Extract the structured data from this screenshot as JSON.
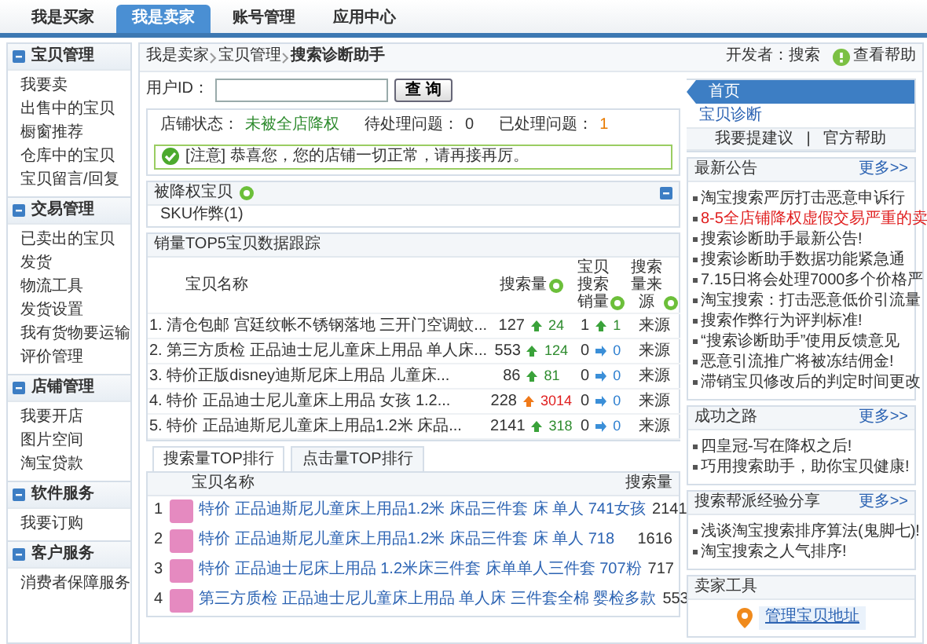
{
  "top_tabs": [
    {
      "label": "我是买家",
      "selected": false
    },
    {
      "label": "我是卖家",
      "selected": true
    },
    {
      "label": "账号管理",
      "selected": false
    },
    {
      "label": "应用中心",
      "selected": false
    }
  ],
  "sidebar": {
    "groups": [
      {
        "title": "宝贝管理",
        "items": [
          "我要卖",
          "出售中的宝贝",
          "橱窗推荐",
          "仓库中的宝贝",
          "宝贝留言/回复"
        ]
      },
      {
        "title": "交易管理",
        "items": [
          "已卖出的宝贝",
          "发货",
          "物流工具",
          "发货设置",
          "我有货物要运输",
          "评价管理"
        ]
      },
      {
        "title": "店铺管理",
        "items": [
          "我要开店",
          "图片空间",
          "淘宝贷款"
        ]
      },
      {
        "title": "软件服务",
        "items": [
          "我要订购"
        ]
      },
      {
        "title": "客户服务",
        "items": [
          "消费者保障服务"
        ]
      }
    ]
  },
  "breadcrumb": [
    "我是卖家",
    "宝贝管理",
    "搜索诊断助手"
  ],
  "developer": "开发者：搜索",
  "help_link": "查看帮助",
  "user_id": {
    "label": "用户ID：",
    "button": "查 询"
  },
  "status": {
    "shop_label": "店铺状态：",
    "shop_value": "未被全店降权",
    "pending_label": "待处理问题：",
    "pending_value": "0",
    "handled_label": "已处理问题：",
    "handled_value": "1"
  },
  "notice": "[注意] 恭喜您，您的店铺一切正常，请再接再厉。",
  "demoted": {
    "title": "被降权宝贝",
    "items": [
      "SKU作弊(1)"
    ]
  },
  "top5": {
    "title": "销量TOP5宝贝数据跟踪",
    "columns": [
      "宝贝名称",
      "搜索量",
      "宝贝搜索销量",
      "搜索量来源"
    ],
    "rows": [
      {
        "name": "1. 清仓包邮 宫廷纹帐不锈钢落地 三开门空调蚊...",
        "search": {
          "value": "127",
          "change": "24",
          "kind": "up"
        },
        "sales": {
          "value": "1",
          "change": "1",
          "kind": "up"
        },
        "source": "来源"
      },
      {
        "name": "2. 第三方质检 正品迪士尼儿童床上用品 单人床...",
        "search": {
          "value": "553",
          "change": "124",
          "kind": "up"
        },
        "sales": {
          "value": "0",
          "change": "0",
          "kind": "flat"
        },
        "source": "来源"
      },
      {
        "name": "3. 特价正版disney迪斯尼床上用品 儿童床...",
        "search": {
          "value": "86",
          "change": "81",
          "kind": "up"
        },
        "sales": {
          "value": "0",
          "change": "0",
          "kind": "flat"
        },
        "source": "来源"
      },
      {
        "name": "4. 特价 正品迪士尼儿童床上用品 女孩 1.2...",
        "search": {
          "value": "228",
          "change": "3014",
          "kind": "surge"
        },
        "sales": {
          "value": "0",
          "change": "0",
          "kind": "flat"
        },
        "source": "来源"
      },
      {
        "name": "5. 特价 正品迪斯尼儿童床上用品1.2米 床品...",
        "search": {
          "value": "2141",
          "change": "318",
          "kind": "up"
        },
        "sales": {
          "value": "0",
          "change": "0",
          "kind": "flat"
        },
        "source": "来源"
      }
    ]
  },
  "rank_tabs": [
    {
      "label": "搜索量TOP排行",
      "selected": true
    },
    {
      "label": "点击量TOP排行",
      "selected": false
    }
  ],
  "ranking": {
    "columns": [
      "宝贝名称",
      "搜索量"
    ],
    "rows": [
      {
        "rank": "1",
        "name": "特价 正品迪斯尼儿童床上用品1.2米 床品三件套 床 单人 741女孩",
        "value": "2141"
      },
      {
        "rank": "2",
        "name": "特价 正品迪斯尼儿童床上用品1.2米 床品三件套 床 单人 718",
        "value": "1616"
      },
      {
        "rank": "3",
        "name": "特价 正品迪士尼床上用品 1.2米床三件套 床单单人三件套 707粉",
        "value": "717"
      },
      {
        "rank": "4",
        "name": "第三方质检 正品迪士尼儿童床上用品 单人床 三件套全棉 婴检多款",
        "value": "553"
      }
    ]
  },
  "side_nav": [
    {
      "label": "首页",
      "selected": true
    },
    {
      "label": "宝贝诊断",
      "selected": false
    }
  ],
  "side_links": [
    "我要提建议",
    "|",
    "官方帮助"
  ],
  "panels": [
    {
      "title": "最新公告",
      "more": "更多>>",
      "items": [
        {
          "text": "淘宝搜索严厉打击恶意申诉行",
          "highlight": false
        },
        {
          "text": "8-5全店铺降权虚假交易严重的卖",
          "highlight": true
        },
        {
          "text": "搜索诊断助手最新公告!",
          "highlight": false
        },
        {
          "text": "搜索诊断助手数据功能紧急通",
          "highlight": false
        },
        {
          "text": "7.15日将会处理7000多个价格严",
          "highlight": false
        },
        {
          "text": "淘宝搜索：打击恶意低价引流量",
          "highlight": false
        },
        {
          "text": "搜索作弊行为评判标准!",
          "highlight": false
        },
        {
          "text": "“搜索诊断助手”使用反馈意见",
          "highlight": false
        },
        {
          "text": "恶意引流推广将被冻结佣金!",
          "highlight": false
        },
        {
          "text": "滞销宝贝修改后的判定时间更改",
          "highlight": false
        }
      ]
    },
    {
      "title": "成功之路",
      "more": "更多>>",
      "items": [
        {
          "text": "四皇冠-写在降权之后!",
          "highlight": false
        },
        {
          "text": "巧用搜索助手，助你宝贝健康!",
          "highlight": false
        }
      ]
    },
    {
      "title": "搜索帮派经验分享",
      "more": "更多>>",
      "items": [
        {
          "text": "浅谈淘宝搜索排序算法(鬼脚七)!",
          "highlight": false
        },
        {
          "text": "淘宝搜索之人气排序!",
          "highlight": false
        }
      ]
    }
  ],
  "tools": {
    "title": "卖家工具",
    "button": "管理宝贝地址"
  }
}
